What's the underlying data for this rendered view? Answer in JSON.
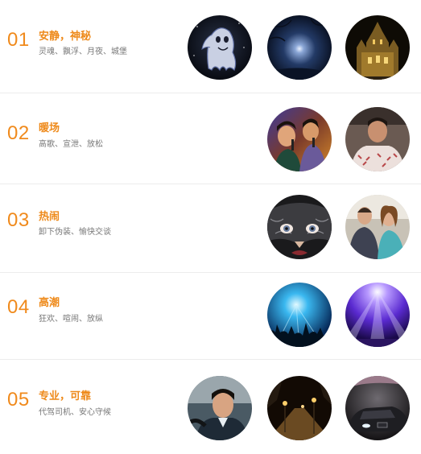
{
  "rows": [
    {
      "num": "01",
      "title": "安静，神秘",
      "subtitle": "灵魂、飘浮、月夜、城堡",
      "images": [
        "ghost-image",
        "moonlit-night-image",
        "castle-night-image"
      ]
    },
    {
      "num": "02",
      "title": "暖场",
      "subtitle": "高歌、宣泄、放松",
      "images": [
        "karaoke-singers-image",
        "relaxing-man-image"
      ]
    },
    {
      "num": "03",
      "title": "热闹",
      "subtitle": "卸下伪装、愉快交谈",
      "images": [
        "masquerade-mask-image",
        "chatting-couple-image"
      ]
    },
    {
      "num": "04",
      "title": "高潮",
      "subtitle": "狂欢、喧闹、放纵",
      "images": [
        "concert-crowd-image",
        "stage-lights-image"
      ]
    },
    {
      "num": "05",
      "title": "专业，可靠",
      "subtitle": "代驾司机、安心守候",
      "images": [
        "driver-image",
        "night-street-image",
        "luxury-car-image"
      ]
    }
  ]
}
